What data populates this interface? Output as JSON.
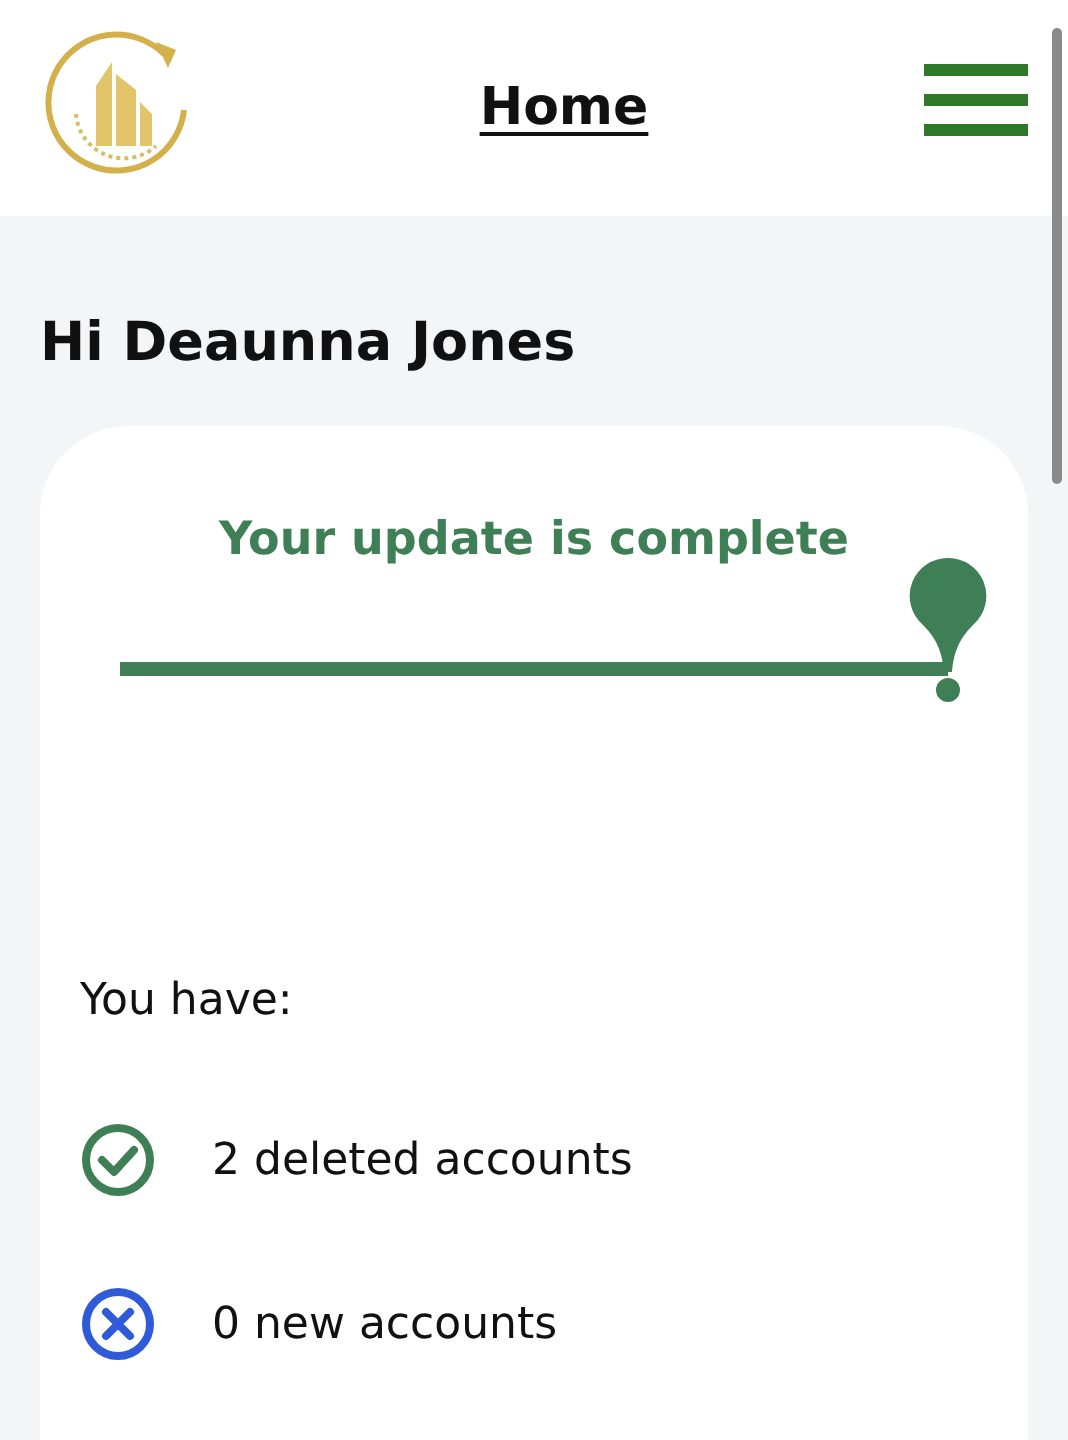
{
  "header": {
    "title": "Home"
  },
  "greeting": "Hi Deaunna Jones",
  "card": {
    "title": "Your update is complete",
    "intro": "You have:",
    "items": [
      {
        "kind": "check",
        "text": "2 deleted accounts"
      },
      {
        "kind": "cross",
        "text": "0 new accounts"
      }
    ]
  }
}
